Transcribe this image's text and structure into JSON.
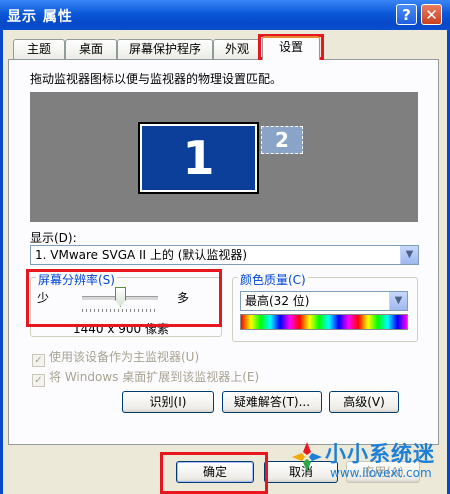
{
  "window": {
    "title": "显示 属性",
    "help_label": "?",
    "close_label": "✕"
  },
  "tabs": [
    {
      "label": "主题"
    },
    {
      "label": "桌面"
    },
    {
      "label": "屏幕保护程序"
    },
    {
      "label": "外观"
    },
    {
      "label": "设置",
      "active": true
    }
  ],
  "settings": {
    "hint": "拖动监视器图标以便与监视器的物理设置匹配。",
    "monitors": [
      {
        "label": "1",
        "primary": true
      },
      {
        "label": "2"
      }
    ],
    "display_label": "显示(D):",
    "display_value": "1. VMware SVGA II 上的 (默认监视器)",
    "resolution": {
      "title": "屏幕分辨率(S)",
      "less_label": "少",
      "more_label": "多",
      "value_text": "1440 x 900 像素",
      "slider_level_percent": 45
    },
    "color_quality": {
      "title": "颜色质量(C)",
      "value": "最高(32 位)"
    },
    "checkboxes": [
      {
        "label": "使用该设备作为主监视器(U)",
        "checked": true,
        "disabled": true
      },
      {
        "label": "将 Windows 桌面扩展到该监视器上(E)",
        "checked": true,
        "disabled": true
      }
    ],
    "buttons": {
      "identify": "识别(I)",
      "troubleshoot": "疑难解答(T)...",
      "advanced": "高级(V)"
    }
  },
  "footer": {
    "ok": "确定",
    "cancel": "取消",
    "apply": "应用(A)"
  },
  "watermark": {
    "text": "小小系统迷",
    "url": "www.ilovext.com"
  },
  "colors": {
    "titlebar": "#0a58d8",
    "highlight": "#e8171f",
    "monitor_primary": "#0b3f9a",
    "group_title": "#0046d5"
  }
}
